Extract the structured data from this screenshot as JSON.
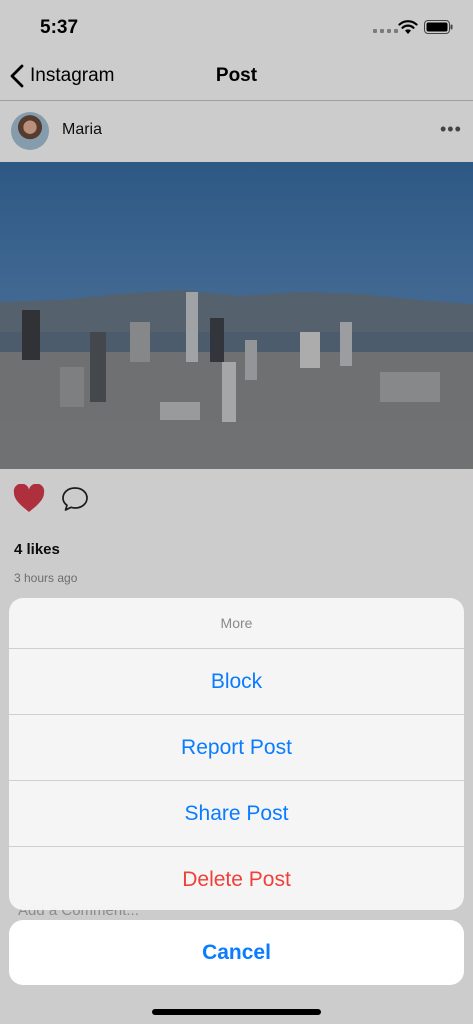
{
  "status_bar": {
    "time": "5:37"
  },
  "nav": {
    "back_label": "Instagram",
    "title": "Post"
  },
  "post": {
    "username": "Maria",
    "more_label": "•••",
    "likes": "4 likes",
    "timestamp": "3 hours ago",
    "comment_placeholder": "Add a Comment...",
    "liked": true
  },
  "action_sheet": {
    "title": "More",
    "buttons": [
      {
        "label": "Block",
        "style": "default"
      },
      {
        "label": "Report Post",
        "style": "default"
      },
      {
        "label": "Share Post",
        "style": "default"
      },
      {
        "label": "Delete Post",
        "style": "destructive"
      }
    ],
    "cancel_label": "Cancel"
  },
  "colors": {
    "accent": "#0a7cff",
    "destructive": "#f0403a",
    "heart": "#d93c4c"
  }
}
